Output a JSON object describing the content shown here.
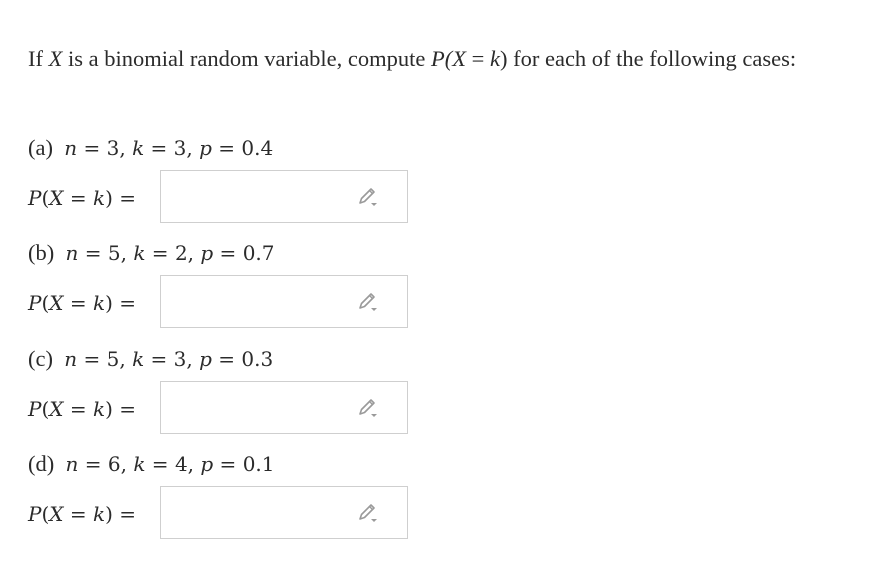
{
  "question": {
    "intro_prefix": "If ",
    "intro_var": "X",
    "intro_mid": " is a binomial random variable, compute ",
    "intro_p_open": "P(",
    "intro_p_var_x": "X",
    "intro_p_eq": " = ",
    "intro_p_var_k": "k",
    "intro_p_close": ")",
    "intro_suffix": " for each of the following cases:"
  },
  "parts": [
    {
      "letter": "(a)",
      "n_label": "n",
      "n": "3",
      "k_label": "k",
      "k": "3",
      "p_label": "p",
      "p": "0.4",
      "answer_value": ""
    },
    {
      "letter": "(b)",
      "n_label": "n",
      "n": "5",
      "k_label": "k",
      "k": "2",
      "p_label": "p",
      "p": "0.7",
      "answer_value": ""
    },
    {
      "letter": "(c)",
      "n_label": "n",
      "n": "5",
      "k_label": "k",
      "k": "3",
      "p_label": "p",
      "p": "0.3",
      "answer_value": ""
    },
    {
      "letter": "(d)",
      "n_label": "n",
      "n": "6",
      "k_label": "k",
      "k": "4",
      "p_label": "p",
      "p": "0.1",
      "answer_value": ""
    }
  ],
  "answer_label": {
    "p": "P",
    "open": "(",
    "x": "X",
    "eq": " = ",
    "k": "k",
    "close_eq": ") ="
  },
  "icons": {
    "answer_tool": "pencil-icon"
  },
  "colors": {
    "text": "#2b2b2b",
    "box_border": "#cfcfcf",
    "icon": "#9a9a9a"
  }
}
